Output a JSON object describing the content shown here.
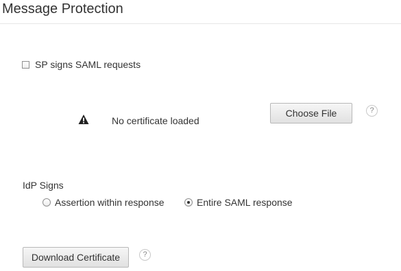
{
  "section": {
    "title": "Message Protection"
  },
  "sp_signs": {
    "label": "SP signs SAML requests",
    "checked": false
  },
  "certificate": {
    "status_text": "No certificate loaded",
    "status_icon": "warning-icon",
    "choose_file_label": "Choose File",
    "help_label": "?"
  },
  "idp_signs": {
    "label": "IdP Signs",
    "options": [
      {
        "label": "Assertion within response",
        "selected": false
      },
      {
        "label": "Entire SAML response",
        "selected": true
      }
    ]
  },
  "download": {
    "button_label": "Download Certificate",
    "help_label": "?"
  }
}
